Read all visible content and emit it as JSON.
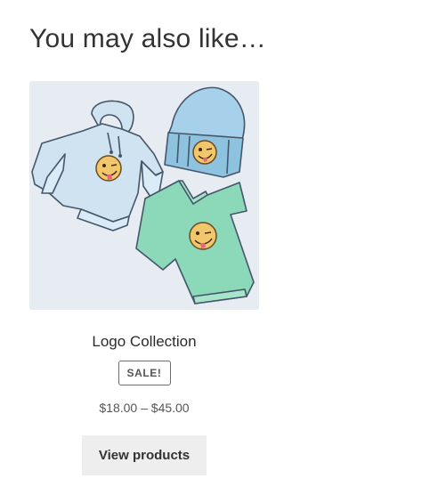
{
  "section": {
    "title": "You may also like…"
  },
  "product": {
    "name": "Logo Collection",
    "sale_badge": "SALE!",
    "price": "$18.00 – $45.00",
    "button_label": "View products",
    "image_alt": "Logo Collection"
  },
  "colors": {
    "image_background": "#e7ecf2",
    "hoodie": "#cfe3f1",
    "beanie": "#8ec3e0",
    "tshirt": "#8bd9b8",
    "emoji": "#f2c66b",
    "button_background": "#eeeeee"
  }
}
